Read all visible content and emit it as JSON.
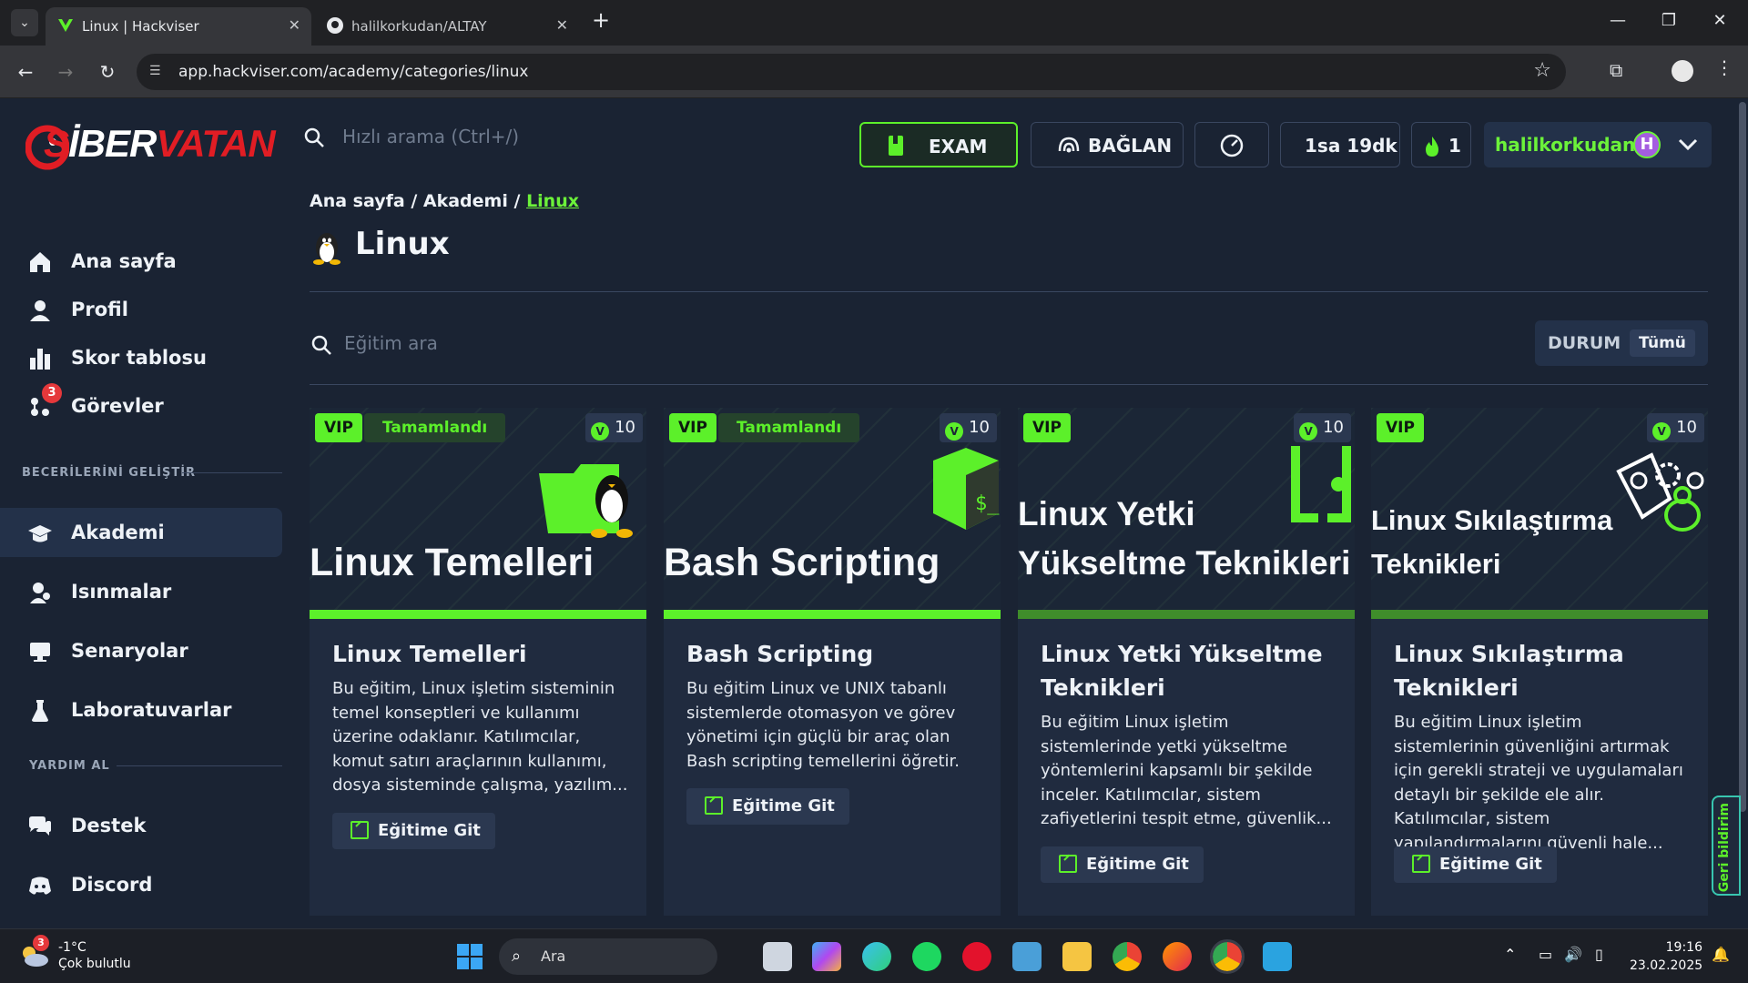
{
  "browser": {
    "tabs": [
      {
        "title": "Linux | Hackviser",
        "active": true
      },
      {
        "title": "halilkorkudan/ALTAY",
        "active": false
      }
    ],
    "url": "app.hackviser.com/academy/categories/linux"
  },
  "logo": {
    "text_red": "S",
    "text_mid": "İBER",
    "text_end": "VATAN"
  },
  "sidebar": {
    "items": [
      {
        "label": "Ana sayfa",
        "icon": "home-icon"
      },
      {
        "label": "Profil",
        "icon": "user-icon"
      },
      {
        "label": "Skor tablosu",
        "icon": "bar-chart-icon"
      },
      {
        "label": "Görevler",
        "icon": "tasks-icon",
        "badge": "3"
      }
    ],
    "section1": "BECERİLERİNİ GELİŞTİR",
    "skills": [
      {
        "label": "Akademi",
        "icon": "graduation-cap-icon",
        "active": true
      },
      {
        "label": "Isınmalar",
        "icon": "warmup-icon"
      },
      {
        "label": "Senaryolar",
        "icon": "scenario-icon"
      },
      {
        "label": "Laboratuvarlar",
        "icon": "flask-icon"
      }
    ],
    "section2": "YARDIM AL",
    "help": [
      {
        "label": "Destek",
        "icon": "chat-icon"
      },
      {
        "label": "Discord",
        "icon": "discord-icon"
      }
    ]
  },
  "header": {
    "search_placeholder": "Hızlı arama (Ctrl+/)",
    "exam_label": "EXAM",
    "connect_label": "BAĞLAN",
    "time_label": "1sa 19dk",
    "streak": "1",
    "username": "halilkorkudan",
    "avatar_letter": "H"
  },
  "breadcrumb": {
    "home": "Ana sayfa",
    "academy": "Akademi",
    "current": "Linux",
    "sep": "/"
  },
  "page": {
    "title": "Linux",
    "search_placeholder": "Eğitim ara",
    "filter_label": "DURUM",
    "filter_value": "Tümü"
  },
  "cards": [
    {
      "vip": "VIP",
      "status": "Tamamlandı",
      "points": "10",
      "banner": "Linux Temelleri",
      "title": "Linux Temelleri",
      "desc": "Bu eğitim, Linux işletim sisteminin temel konseptleri ve kullanımı üzerine odaklanır. Katılımcılar, komut satırı araçlarının kullanımı, dosya sisteminde çalışma, yazılım...",
      "button": "Eğitime Git"
    },
    {
      "vip": "VIP",
      "status": "Tamamlandı",
      "points": "10",
      "banner": "Bash Scripting",
      "title": "Bash Scripting",
      "desc": "Bu eğitim Linux ve UNIX tabanlı sistemlerde otomasyon ve görev yönetimi için güçlü bir araç olan Bash scripting temellerini öğretir.",
      "button": "Eğitime Git"
    },
    {
      "vip": "VIP",
      "status": "",
      "points": "10",
      "banner_line1": "Linux Yetki",
      "banner_line2": "Yükseltme Teknikleri",
      "title": "Linux Yetki Yükseltme Teknikleri",
      "desc": "Bu eğitim Linux işletim sistemlerinde yetki yükseltme yöntemlerini kapsamlı bir şekilde inceler. Katılımcılar, sistem zafiyetlerini tespit etme, güvenlik...",
      "button": "Eğitime Git"
    },
    {
      "vip": "VIP",
      "status": "",
      "points": "10",
      "banner_line1": "Linux Sıkılaştırma",
      "banner_line2": "Teknikleri",
      "title": "Linux Sıkılaştırma Teknikleri",
      "desc": "Bu eğitim Linux işletim sistemlerinin güvenliğini artırmak için gerekli strateji ve uygulamaları detaylı bir şekilde ele alır. Katılımcılar, sistem yapılandırmalarını güvenli hale...",
      "button": "Eğitime Git"
    }
  ],
  "feedback": "Geri bildirim",
  "taskbar": {
    "weather_temp": "-1°C",
    "weather_desc": "Çok bulutlu",
    "weather_badge": "3",
    "search_label": "Ara",
    "time": "19:16",
    "date": "23.02.2025"
  },
  "colors": {
    "accent": "#5cf02a",
    "bg": "#1a2333",
    "card": "#202b3f"
  }
}
